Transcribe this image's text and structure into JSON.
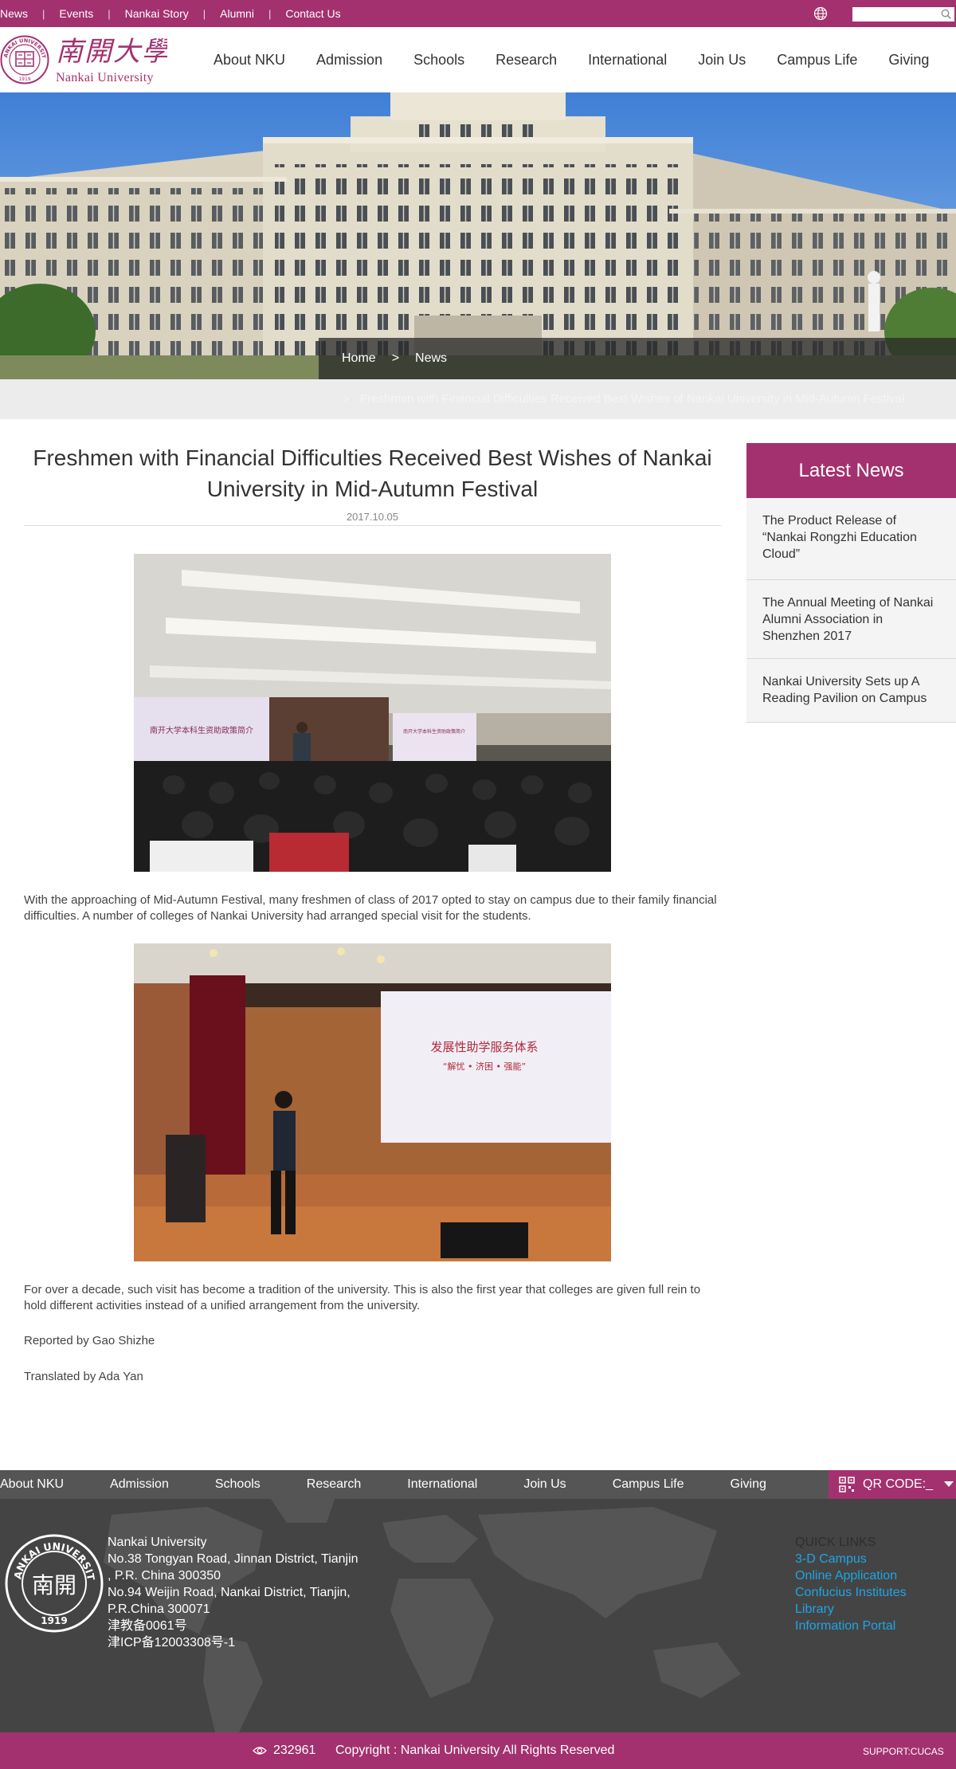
{
  "topbar": {
    "links": [
      "News",
      "Events",
      "Nankai Story",
      "Alumni",
      "Contact Us"
    ],
    "search_placeholder": ""
  },
  "header": {
    "logo_en": "Nankai University",
    "logo_cn": "南開大學",
    "seal_text": "NANKAI UNIVERSITY",
    "seal_year": "1919",
    "nav": [
      "About NKU",
      "Admission",
      "Schools",
      "Research",
      "International",
      "Join Us",
      "Campus Life",
      "Giving"
    ]
  },
  "breadcrumb": {
    "home": "Home",
    "separator": ">",
    "current": "News"
  },
  "subbar": {
    "arrow": ">",
    "title": "Freshmen with Financial Difficulties Received Best Wishes of Nankai University in Mid-Autumn Festival"
  },
  "article": {
    "title": "Freshmen with Financial Difficulties Received Best Wishes of Nankai University in Mid-Autumn Festival",
    "date": "2017.10.05",
    "photo1_screen_left": "南开大学本科生资助政策简介",
    "photo1_screen_right": "南开大学本科生资助政策简介",
    "paragraph1": "With the approaching of Mid-Autumn Festival, many freshmen of class of 2017 opted to stay on campus due to their family financial difficulties. A number of colleges of Nankai University had arranged special visit for the students.",
    "photo2_screen_line1": "发展性助学服务体系",
    "photo2_screen_line2": "“解忧 • 济困 • 强能”",
    "paragraph2": "For over a decade, such visit has become a tradition of the university. This is also the first year that colleges are given full rein to hold different activities instead of a unified arrangement from the university.",
    "reporter": "Reported by Gao Shizhe",
    "translator": "Translated by Ada Yan"
  },
  "sidebar": {
    "heading": "Latest News",
    "items": [
      "The Product Release of “Nankai Rongzhi Education Cloud”",
      "The Annual Meeting of Nankai Alumni Association in Shenzhen 2017",
      "Nankai University Sets up A Reading Pavilion on Campus"
    ]
  },
  "footer": {
    "nav": [
      "About NKU",
      "Admission",
      "Schools",
      "Research",
      "International",
      "Join Us",
      "Campus Life",
      "Giving"
    ],
    "qr_label": "QR CODE:_",
    "seal_text": "NANKAI UNIVERSITY",
    "seal_year": "1919",
    "seal_center": "南開",
    "address_lines": [
      "Nankai University",
      "No.38 Tongyan Road, Jinnan District, Tianjin",
      ", P.R. China 300350",
      "No.94 Weijin Road,  Nankai District, Tianjin,",
      "P.R.China  300071",
      "津教备0061号",
      "津ICP备12003308号-1"
    ],
    "quick_links_heading": "QUICK LINKS",
    "quick_links": [
      "3-D Campus",
      "Online Application",
      "Confucius Institutes",
      "Library",
      "Information Portal"
    ],
    "visit_count": "232961",
    "copyright": "Copyright : Nankai University All Rights Reserved",
    "support": "SUPPORT:CUCAS"
  },
  "colors": {
    "brand": "#a3316f",
    "footer_bg": "#444444",
    "footnav_bg": "#555555",
    "link": "#1ea5e6"
  },
  "icons": {
    "globe": "globe-icon",
    "search": "search-icon",
    "qr": "qr-code-icon",
    "caret": "caret-down-icon",
    "eye": "eye-icon"
  }
}
